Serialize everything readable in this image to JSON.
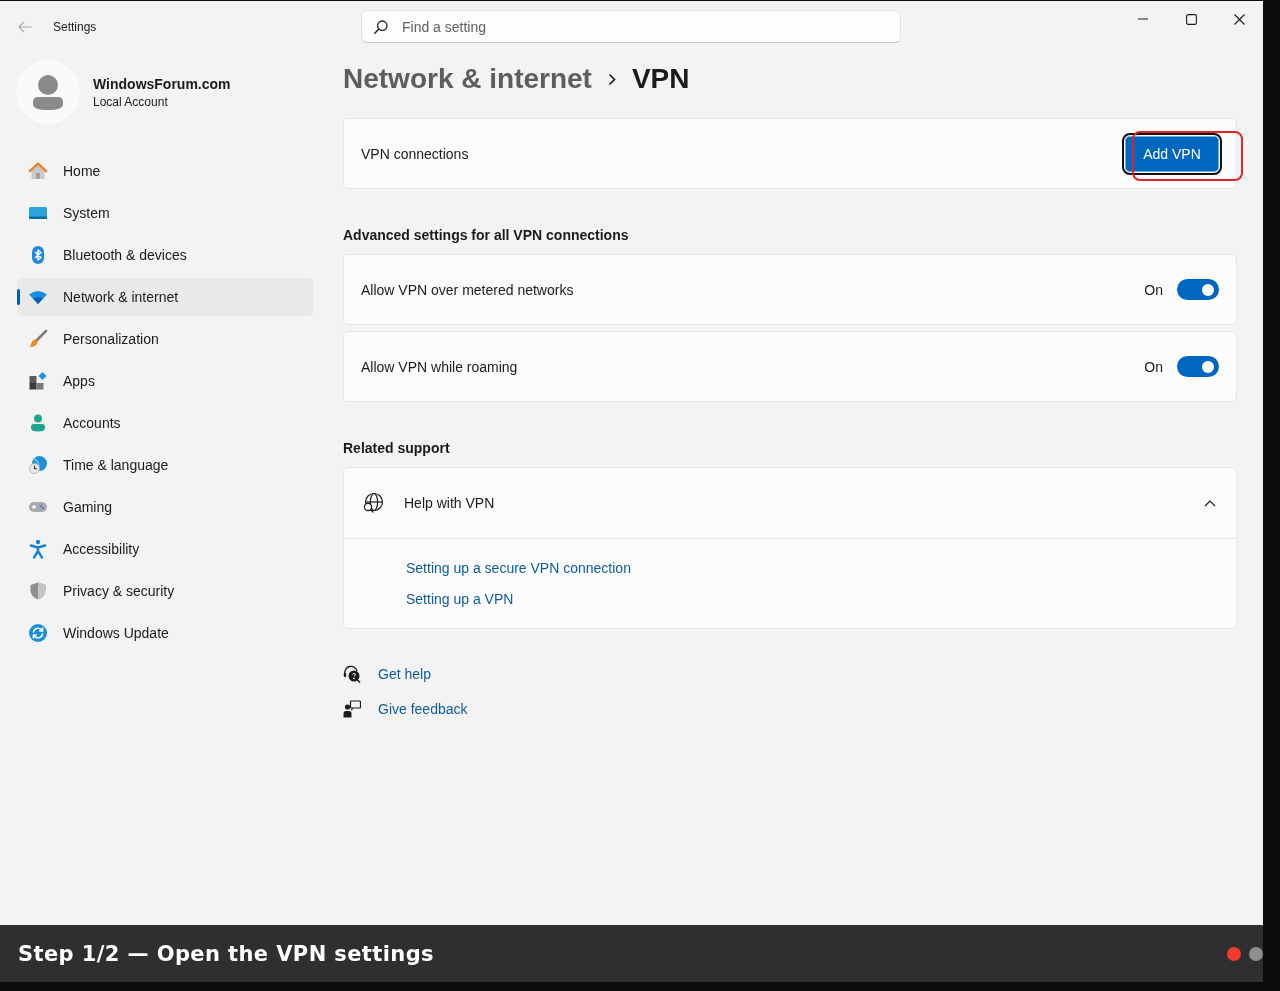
{
  "window": {
    "title": "Settings"
  },
  "search": {
    "placeholder": "Find a setting"
  },
  "account": {
    "name": "WindowsForum.com",
    "type": "Local Account"
  },
  "sidebar": {
    "items": [
      {
        "label": "Home",
        "selected": false
      },
      {
        "label": "System",
        "selected": false
      },
      {
        "label": "Bluetooth & devices",
        "selected": false
      },
      {
        "label": "Network & internet",
        "selected": true
      },
      {
        "label": "Personalization",
        "selected": false
      },
      {
        "label": "Apps",
        "selected": false
      },
      {
        "label": "Accounts",
        "selected": false
      },
      {
        "label": "Time & language",
        "selected": false
      },
      {
        "label": "Gaming",
        "selected": false
      },
      {
        "label": "Accessibility",
        "selected": false
      },
      {
        "label": "Privacy & security",
        "selected": false
      },
      {
        "label": "Windows Update",
        "selected": false
      }
    ]
  },
  "breadcrumb": [
    {
      "label": "Network & internet"
    },
    {
      "label": "VPN"
    }
  ],
  "vpn_connections": {
    "label": "VPN connections",
    "button": {
      "label": "Add VPN",
      "focused": true,
      "highlighted": true
    }
  },
  "advanced": {
    "heading": "Advanced settings for all VPN connections",
    "settings": [
      {
        "label": "Allow VPN over metered networks",
        "state_label": "On",
        "on": true
      },
      {
        "label": "Allow VPN while roaming",
        "state_label": "On",
        "on": true
      }
    ]
  },
  "related_support": {
    "heading": "Related support",
    "help": {
      "title": "Help with VPN",
      "expanded": true,
      "links": [
        "Setting up a secure VPN connection",
        "Setting up a VPN"
      ]
    }
  },
  "footer_links": [
    {
      "label": "Get help"
    },
    {
      "label": "Give feedback"
    }
  ],
  "caption": {
    "text": "Step 1/2 — Open the VPN settings",
    "steps": [
      {
        "selected": true
      },
      {
        "selected": false
      }
    ]
  }
}
